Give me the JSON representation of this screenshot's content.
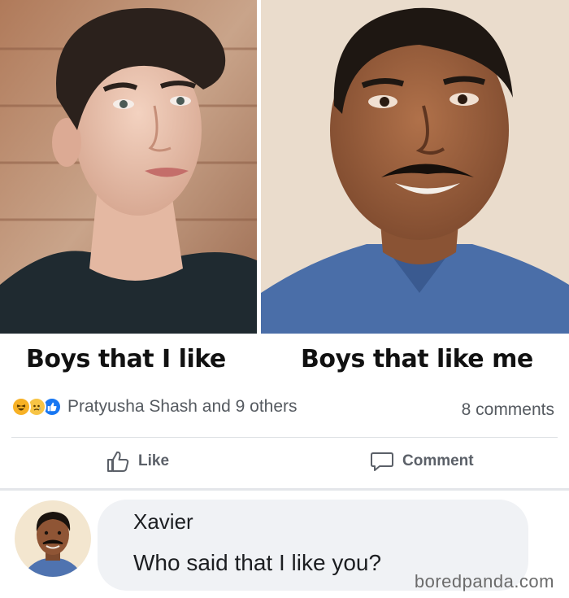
{
  "captions": {
    "left": "Boys that I like",
    "right": "Boys that like me"
  },
  "reactions": {
    "icons": [
      "haha-icon",
      "sad-icon",
      "like-icon"
    ],
    "names": "Pratyusha Shash and 9 others",
    "comments_count": "8 comments"
  },
  "actions": {
    "like_label": "Like",
    "comment_label": "Comment"
  },
  "comment": {
    "author": "Xavier",
    "text": "Who said that I like you?"
  },
  "watermark": "boredpanda.com",
  "colors": {
    "like_blue": "#1877f2",
    "haha_yellow": "#f7b125",
    "bubble_bg": "#f0f2f5",
    "meta_text": "#555a60"
  }
}
